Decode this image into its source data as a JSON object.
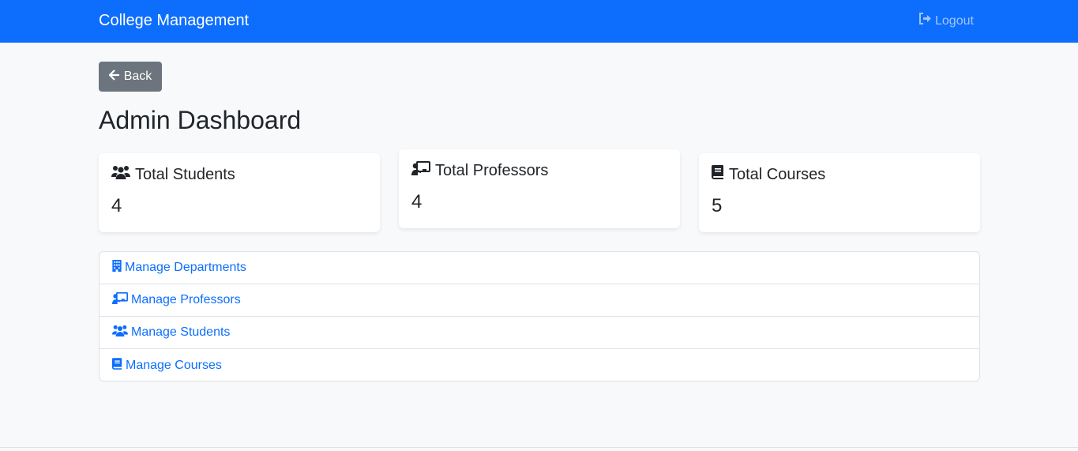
{
  "navbar": {
    "brand": "College Management",
    "logout_label": "Logout",
    "logout_icon": "sign-out-icon",
    "background": "#0d6efd"
  },
  "back_button": {
    "label": "Back",
    "icon": "arrow-left-icon",
    "background": "#6c757d"
  },
  "page_title": "Admin Dashboard",
  "stats": [
    {
      "label": "Total Students",
      "value": "4",
      "icon": "users-icon"
    },
    {
      "label": "Total Professors",
      "value": "4",
      "icon": "chalkboard-teacher-icon"
    },
    {
      "label": "Total Courses",
      "value": "5",
      "icon": "book-icon"
    }
  ],
  "manage_links": [
    {
      "label": "Manage Departments",
      "icon": "building-icon"
    },
    {
      "label": "Manage Professors",
      "icon": "chalkboard-teacher-icon"
    },
    {
      "label": "Manage Students",
      "icon": "users-icon"
    },
    {
      "label": "Manage Courses",
      "icon": "book-icon"
    }
  ],
  "link_color": "#0d6efd"
}
